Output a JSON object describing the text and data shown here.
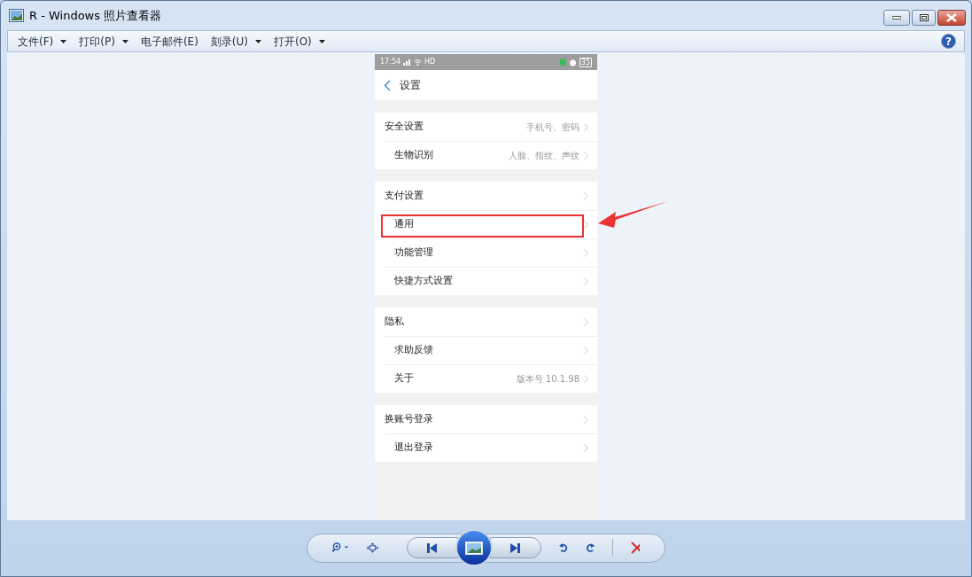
{
  "window": {
    "title": "R - Windows 照片查看器"
  },
  "menu": [
    {
      "label": "文件(F)",
      "dropdown": true
    },
    {
      "label": "打印(P)",
      "dropdown": true
    },
    {
      "label": "电子邮件(E)",
      "dropdown": false
    },
    {
      "label": "刻录(U)",
      "dropdown": true
    },
    {
      "label": "打开(O)",
      "dropdown": true
    }
  ],
  "help": {
    "label": "?"
  },
  "phone": {
    "status_bar": {
      "time": "17:54",
      "network": "HD",
      "battery": "35"
    },
    "header": {
      "title": "设置"
    },
    "groups": [
      [
        {
          "label": "安全设置",
          "value": "手机号、密码",
          "highlighted": false
        },
        {
          "label": "生物识别",
          "value": "人脸、指纹、声纹",
          "highlighted": false
        }
      ],
      [
        {
          "label": "支付设置",
          "highlighted": false
        },
        {
          "label": "通用",
          "highlighted": true
        },
        {
          "label": "功能管理",
          "highlighted": false
        },
        {
          "label": "快捷方式设置",
          "highlighted": false
        }
      ],
      [
        {
          "label": "隐私",
          "highlighted": false
        },
        {
          "label": "求助反馈",
          "highlighted": false
        },
        {
          "label": "关于",
          "value": "版本号 10.1.98",
          "highlighted": false
        }
      ],
      [
        {
          "label": "换账号登录",
          "highlighted": false
        },
        {
          "label": "退出登录",
          "highlighted": false
        }
      ]
    ]
  }
}
